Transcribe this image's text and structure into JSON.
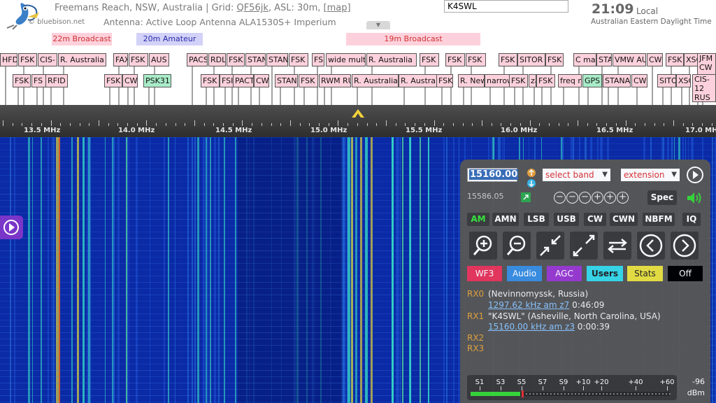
{
  "header": {
    "location": "Freemans Reach, NSW, Australia | Grid: ",
    "grid": "QF56jk",
    "asl": ", ASL: 30m, ",
    "map_link": "[map]",
    "antenna": "Antenna: Active Loop Antenna ALA1530S+ Imperium",
    "credit": "© bluebison.net",
    "callsign_value": "K4SWL",
    "time": "21:09",
    "time_label": "Local",
    "timezone": "Australian Eastern Daylight Time"
  },
  "bands": [
    {
      "label": "22m Broadcast",
      "color": "#fdd1dc",
      "text_color": "#d03030"
    },
    {
      "label": "20m Amateur",
      "color": "#d2d2f8",
      "text_color": "#2a2aaa"
    },
    {
      "label": "19m Broadcast",
      "color": "#fdd1dc",
      "text_color": "#d03030"
    }
  ],
  "labels_row1": [
    "HFD",
    "FSK",
    "CIS-",
    "R. Australia",
    "FAX",
    "FSK",
    "AUS",
    "PACS",
    "RDL",
    "FSK",
    "STAN",
    "STAN",
    "FSK",
    "FS",
    "wide mult",
    "R. Australia",
    "FSK",
    "FSK",
    "FSK",
    "FSK",
    "SITOR",
    "FSK",
    "C ma",
    "STA",
    "VMW AU",
    "CW",
    "FSK",
    "XSC",
    "JFM CW"
  ],
  "labels_row2": [
    "FSK",
    "FS",
    "RFID",
    "FSK",
    "CW",
    "PSK31",
    "FSK",
    "FSI",
    "PACT",
    "CW",
    "STAN",
    "FSK",
    "RWM RU",
    "R. Australia",
    "R. Austra",
    "FSK",
    "R. New",
    "narrow",
    "FSK",
    "za",
    "FSK",
    "freq m",
    "GPS",
    "STANA",
    "CW",
    "SITO",
    "XSC",
    "CIS-12 RUS"
  ],
  "scale": {
    "mhz_labels": [
      "13.5 MHz",
      "14.0 MHz",
      "14.5 MHz",
      "15.0 MHz",
      "15.5 MHz",
      "16.0 MHz",
      "16.5 MHz",
      "17.0 MHz"
    ]
  },
  "panel": {
    "frequency": "15160.00",
    "select_band": "select band",
    "extension": "extension",
    "secondary_freq": "15586.05",
    "spec_label": "Spec",
    "modes": [
      "AM",
      "AMN",
      "LSB",
      "USB",
      "CW",
      "CWN",
      "NBFM",
      "IQ"
    ],
    "active_mode": "AM",
    "color_buttons": [
      {
        "label": "WF3",
        "color": "#e8365b",
        "text": "#ffffff"
      },
      {
        "label": "Audio",
        "color": "#3a8fe0",
        "text": "#ffffff"
      },
      {
        "label": "AGC",
        "color": "#9a3ad0",
        "text": "#ffffff"
      },
      {
        "label": "Users",
        "color": "#38d8e8",
        "text": "#222222"
      },
      {
        "label": "Stats",
        "color": "#e8e040",
        "text": "#222222"
      },
      {
        "label": "Off",
        "color": "#000000",
        "text": "#ffffff"
      }
    ],
    "rx": [
      {
        "id": "RX0",
        "text": "(Nevinnomyssk, Russia)",
        "link": "1297.62 kHz am z7",
        "time": " 0:46:09"
      },
      {
        "id": "RX1",
        "text": "\"K4SWL\" (Asheville, North Carolina, USA)",
        "link": "15160.00 kHz am z3",
        "time": " 0:00:39"
      },
      {
        "id": "RX2",
        "text": "",
        "link": "",
        "time": ""
      },
      {
        "id": "RX3",
        "text": "",
        "link": "",
        "time": ""
      }
    ],
    "smeter_labels": [
      "S1",
      "S3",
      "S5",
      "S7",
      "S9",
      "+10",
      "+20",
      "+40",
      "+60"
    ],
    "dbm_value": "-96",
    "dbm_unit": "dBm",
    "smeter_level": 0.25
  },
  "colors": {
    "label_bg": "#fdd1dc",
    "label_green": "#a8ecc8",
    "panel_bg": "#575757",
    "active_mode": "#38e838"
  }
}
